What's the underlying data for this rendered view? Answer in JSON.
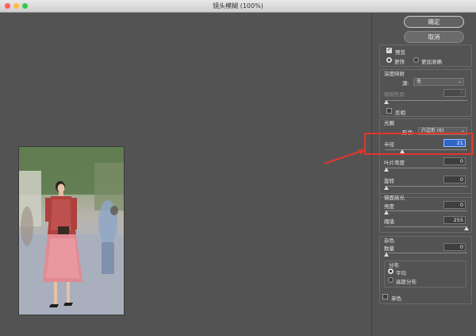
{
  "window": {
    "title": "镜头模糊 (100%)"
  },
  "buttons": {
    "ok": "确定",
    "cancel": "取消"
  },
  "preview": {
    "label": "预览",
    "checked": true,
    "mode_fast": "更快",
    "mode_accurate": "更加准确",
    "selected_mode": "更快"
  },
  "depth_map": {
    "title": "深度映射",
    "source_label": "源:",
    "source_value": "无",
    "blur_focal_label": "模糊焦距",
    "blur_focal_value": "0",
    "invert_label": "反相"
  },
  "iris": {
    "title": "光圈",
    "shape_label": "形状:",
    "shape_value": "六边形 (6)",
    "radius_label": "半径",
    "radius_value": "21",
    "radius_slider_fraction": 0.21,
    "curvature_label": "叶片弯度",
    "curvature_value": "0",
    "rotation_label": "旋转",
    "rotation_value": "0"
  },
  "specular": {
    "title": "镜面高光",
    "brightness_label": "亮度",
    "brightness_value": "0",
    "threshold_label": "阈值",
    "threshold_value": "255"
  },
  "noise": {
    "title": "杂色",
    "amount_label": "数量",
    "amount_value": "0",
    "distribution_title": "分布",
    "uniform_label": "平均",
    "gaussian_label": "高斯分布",
    "selected_distribution": "平均",
    "mono_label": "单色"
  },
  "colors": {
    "annotation_red": "#e0362b",
    "active_field": "#2f66c8",
    "panel_bg": "#535353"
  },
  "icons": [
    "close-dot-icon",
    "minimize-dot-icon",
    "zoom-dot-icon",
    "dropdown-arrow-icon",
    "annotation-arrow-icon"
  ]
}
